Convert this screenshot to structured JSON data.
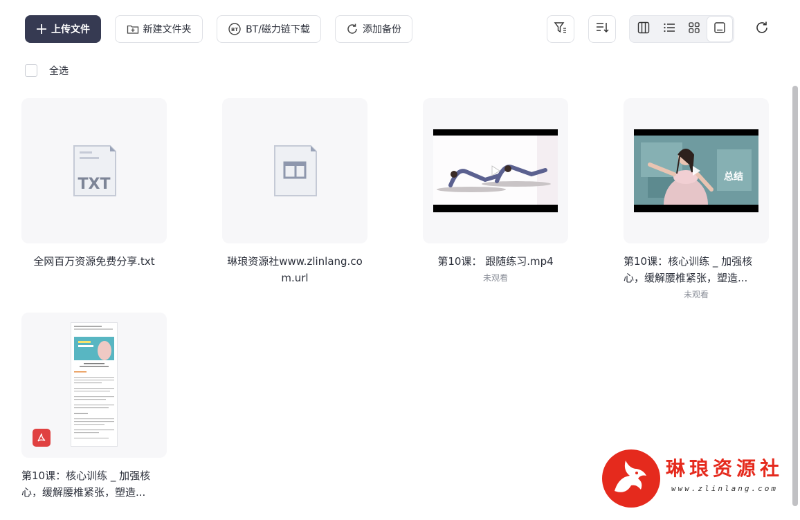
{
  "toolbar": {
    "upload_label": "上传文件",
    "new_folder_label": "新建文件夹",
    "bt_label": "BT/磁力链下载",
    "backup_label": "添加备份",
    "bt_badge": "BT"
  },
  "select_all_label": "全选",
  "files": [
    {
      "name": "全网百万资源免费分享.txt",
      "type": "txt",
      "icon_text": "TXT",
      "status": ""
    },
    {
      "name": "琳琅资源社www.zlinlang.com.url",
      "type": "url",
      "status": ""
    },
    {
      "name": "第10课： 跟随练习.mp4",
      "type": "video",
      "status": "未观看"
    },
    {
      "name": "第10课：核心训练 _ 加强核心，缓解腰椎紧张，塑造...",
      "type": "video",
      "status": "未观看",
      "overlay": "总结"
    },
    {
      "name": "第10课：核心训练 _ 加强核心，缓解腰椎紧张，塑造...",
      "type": "pdf",
      "status": ""
    }
  ],
  "watermark": {
    "title": "琳琅资源社",
    "subtitle": "www.zlinlang.com"
  },
  "colors": {
    "primary": "#363a52",
    "brand_red": "#e52a1d",
    "muted": "#8b8f99"
  }
}
